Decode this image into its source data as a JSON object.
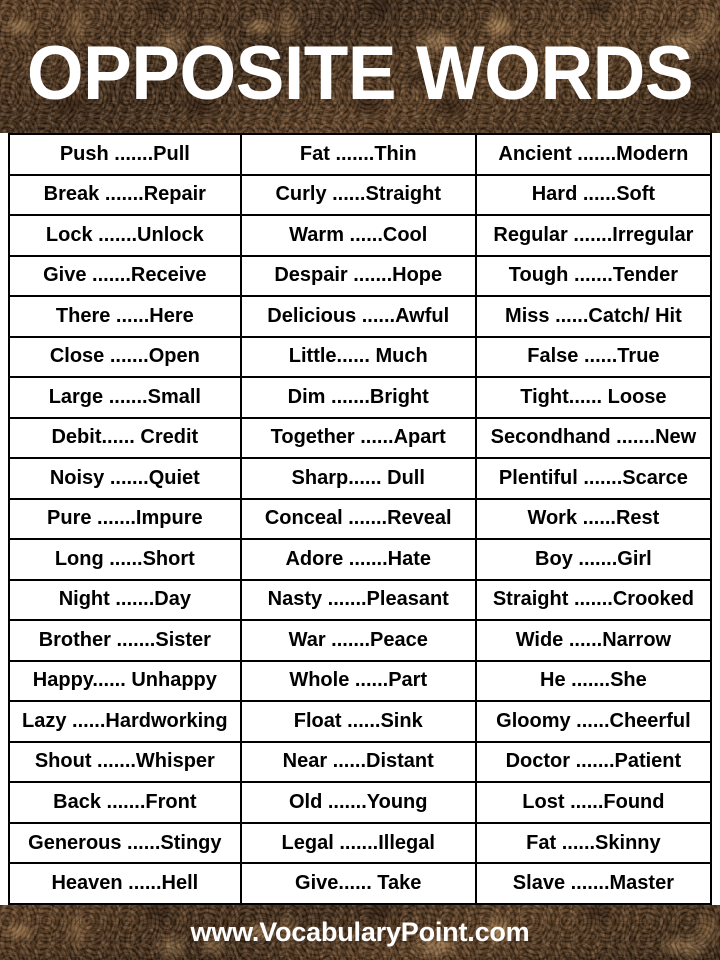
{
  "header": {
    "title": "OPPOSITE WORDS",
    "background_color": "#55371f",
    "title_color": "#ffffff"
  },
  "table": {
    "border_color": "#000000",
    "background_color": "#ffffff",
    "text_color": "#000000",
    "columns": 3,
    "row_count": 19,
    "rows": [
      [
        "Push .......Pull",
        "Fat .......Thin",
        "Ancient .......Modern"
      ],
      [
        "Break .......Repair",
        "Curly ......Straight",
        "Hard ......Soft"
      ],
      [
        "Lock .......Unlock",
        "Warm ......Cool",
        "Regular .......Irregular"
      ],
      [
        "Give .......Receive",
        "Despair .......Hope",
        "Tough .......Tender"
      ],
      [
        "There ......Here",
        "Delicious ......Awful",
        "Miss ......Catch/ Hit"
      ],
      [
        "Close .......Open",
        "Little...... Much",
        "False ......True"
      ],
      [
        "Large .......Small",
        "Dim .......Bright",
        "Tight...... Loose"
      ],
      [
        "Debit...... Credit",
        "Together ......Apart",
        "Secondhand .......New"
      ],
      [
        "Noisy .......Quiet",
        "Sharp...... Dull",
        "Plentiful .......Scarce"
      ],
      [
        "Pure .......Impure",
        "Conceal .......Reveal",
        "Work ......Rest"
      ],
      [
        "Long ......Short",
        "Adore .......Hate",
        "Boy .......Girl"
      ],
      [
        "Night .......Day",
        "Nasty .......Pleasant",
        "Straight .......Crooked"
      ],
      [
        "Brother .......Sister",
        "War .......Peace",
        "Wide ......Narrow"
      ],
      [
        "Happy...... Unhappy",
        "Whole ......Part",
        "He .......She"
      ],
      [
        "Lazy ......Hardworking",
        "Float ......Sink",
        "Gloomy ......Cheerful"
      ],
      [
        "Shout .......Whisper",
        "Near ......Distant",
        "Doctor .......Patient"
      ],
      [
        "Back .......Front",
        "Old .......Young",
        "Lost ......Found"
      ],
      [
        "Generous ......Stingy",
        "Legal .......Illegal",
        "Fat ......Skinny"
      ],
      [
        "Heaven ......Hell",
        "Give...... Take",
        "Slave .......Master"
      ]
    ]
  },
  "footer": {
    "website": "www.VocabularyPoint.com",
    "text_color": "#ffffff"
  }
}
